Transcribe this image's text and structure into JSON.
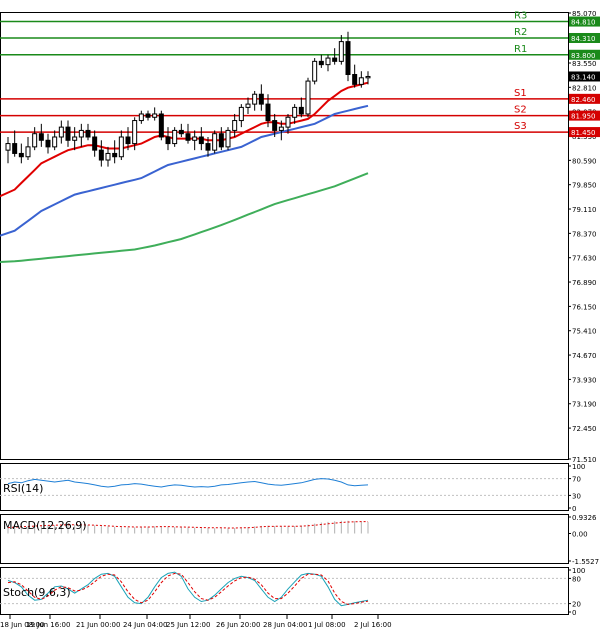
{
  "chart_data": {
    "type": "line",
    "instrument_hint": "",
    "price_axis": {
      "ylim": [
        71.51,
        85.07
      ],
      "ticks": [
        "85.070",
        "84.290",
        "83.550",
        "82.810",
        "82.070",
        "81.330",
        "80.590",
        "79.850",
        "79.110",
        "78.370",
        "77.630",
        "76.890",
        "76.150",
        "75.410",
        "74.670",
        "73.930",
        "73.190",
        "72.450",
        "71.510"
      ]
    },
    "time_labels": [
      "18 Jun 08:00",
      "19 Jun 16:00",
      "21 Jun 00:00",
      "24 Jun 04:00",
      "25 Jun 12:00",
      "26 Jun 20:00",
      "28 Jun 04:00",
      "1 Jul 08:00",
      "2 Jul 16:00"
    ],
    "current_price": {
      "label": "83.140",
      "value": 83.14
    },
    "levels": [
      {
        "name": "R3",
        "value": 84.81,
        "label": "84.810",
        "color": "#1a8a1a"
      },
      {
        "name": "R2",
        "value": 84.31,
        "label": "84.310",
        "color": "#1a8a1a"
      },
      {
        "name": "R1",
        "value": 83.8,
        "label": "83.800",
        "color": "#1a8a1a"
      },
      {
        "name": "S1",
        "value": 82.46,
        "label": "82.460",
        "color": "#d40000"
      },
      {
        "name": "S2",
        "value": 81.95,
        "label": "81.950",
        "color": "#d40000"
      },
      {
        "name": "S3",
        "value": 81.45,
        "label": "81.450",
        "color": "#d40000"
      }
    ],
    "candles": [
      {
        "o": 80.9,
        "h": 81.3,
        "l": 80.5,
        "c": 81.1
      },
      {
        "o": 81.1,
        "h": 81.5,
        "l": 80.7,
        "c": 80.8
      },
      {
        "o": 80.8,
        "h": 81.1,
        "l": 80.5,
        "c": 80.7
      },
      {
        "o": 80.7,
        "h": 81.3,
        "l": 80.6,
        "c": 81.0
      },
      {
        "o": 81.0,
        "h": 81.6,
        "l": 80.9,
        "c": 81.4
      },
      {
        "o": 81.4,
        "h": 81.7,
        "l": 81.0,
        "c": 81.2
      },
      {
        "o": 81.2,
        "h": 81.4,
        "l": 80.8,
        "c": 81.0
      },
      {
        "o": 81.0,
        "h": 81.5,
        "l": 80.9,
        "c": 81.3
      },
      {
        "o": 81.3,
        "h": 81.8,
        "l": 81.1,
        "c": 81.6
      },
      {
        "o": 81.6,
        "h": 81.8,
        "l": 81.0,
        "c": 81.2
      },
      {
        "o": 81.2,
        "h": 81.6,
        "l": 80.9,
        "c": 81.3
      },
      {
        "o": 81.3,
        "h": 81.7,
        "l": 81.0,
        "c": 81.5
      },
      {
        "o": 81.5,
        "h": 81.7,
        "l": 81.2,
        "c": 81.3
      },
      {
        "o": 81.3,
        "h": 81.5,
        "l": 80.7,
        "c": 80.9
      },
      {
        "o": 80.9,
        "h": 81.2,
        "l": 80.4,
        "c": 80.6
      },
      {
        "o": 80.6,
        "h": 81.0,
        "l": 80.4,
        "c": 80.8
      },
      {
        "o": 80.8,
        "h": 81.2,
        "l": 80.5,
        "c": 80.7
      },
      {
        "o": 80.7,
        "h": 81.5,
        "l": 80.6,
        "c": 81.3
      },
      {
        "o": 81.3,
        "h": 81.6,
        "l": 80.9,
        "c": 81.1
      },
      {
        "o": 81.1,
        "h": 81.9,
        "l": 80.9,
        "c": 81.8
      },
      {
        "o": 81.8,
        "h": 82.1,
        "l": 81.7,
        "c": 82.0
      },
      {
        "o": 82.0,
        "h": 82.1,
        "l": 81.8,
        "c": 81.9
      },
      {
        "o": 81.9,
        "h": 82.2,
        "l": 81.8,
        "c": 82.0
      },
      {
        "o": 82.0,
        "h": 82.1,
        "l": 81.2,
        "c": 81.3
      },
      {
        "o": 81.3,
        "h": 81.6,
        "l": 80.9,
        "c": 81.1
      },
      {
        "o": 81.1,
        "h": 81.6,
        "l": 81.0,
        "c": 81.5
      },
      {
        "o": 81.5,
        "h": 81.7,
        "l": 81.3,
        "c": 81.4
      },
      {
        "o": 81.4,
        "h": 81.7,
        "l": 81.1,
        "c": 81.2
      },
      {
        "o": 81.2,
        "h": 81.5,
        "l": 80.9,
        "c": 81.3
      },
      {
        "o": 81.3,
        "h": 81.6,
        "l": 80.9,
        "c": 81.1
      },
      {
        "o": 81.1,
        "h": 81.3,
        "l": 80.7,
        "c": 80.9
      },
      {
        "o": 80.9,
        "h": 81.5,
        "l": 80.8,
        "c": 81.4
      },
      {
        "o": 81.4,
        "h": 81.6,
        "l": 80.9,
        "c": 81.0
      },
      {
        "o": 81.0,
        "h": 81.6,
        "l": 80.9,
        "c": 81.5
      },
      {
        "o": 81.5,
        "h": 82.0,
        "l": 81.3,
        "c": 81.8
      },
      {
        "o": 81.8,
        "h": 82.3,
        "l": 81.6,
        "c": 82.2
      },
      {
        "o": 82.2,
        "h": 82.5,
        "l": 82.0,
        "c": 82.3
      },
      {
        "o": 82.3,
        "h": 82.7,
        "l": 82.1,
        "c": 82.6
      },
      {
        "o": 82.6,
        "h": 82.9,
        "l": 82.1,
        "c": 82.3
      },
      {
        "o": 82.3,
        "h": 82.6,
        "l": 81.6,
        "c": 81.8
      },
      {
        "o": 81.8,
        "h": 82.0,
        "l": 81.3,
        "c": 81.5
      },
      {
        "o": 81.5,
        "h": 81.8,
        "l": 81.2,
        "c": 81.6
      },
      {
        "o": 81.6,
        "h": 82.0,
        "l": 81.4,
        "c": 81.9
      },
      {
        "o": 81.9,
        "h": 82.3,
        "l": 81.7,
        "c": 82.2
      },
      {
        "o": 82.2,
        "h": 82.5,
        "l": 81.9,
        "c": 82.0
      },
      {
        "o": 82.0,
        "h": 83.1,
        "l": 81.9,
        "c": 83.0
      },
      {
        "o": 83.0,
        "h": 83.7,
        "l": 82.9,
        "c": 83.6
      },
      {
        "o": 83.6,
        "h": 83.8,
        "l": 83.4,
        "c": 83.5
      },
      {
        "o": 83.5,
        "h": 83.8,
        "l": 83.3,
        "c": 83.7
      },
      {
        "o": 83.7,
        "h": 84.0,
        "l": 83.5,
        "c": 83.6
      },
      {
        "o": 83.6,
        "h": 84.4,
        "l": 83.5,
        "c": 84.2
      },
      {
        "o": 84.2,
        "h": 84.5,
        "l": 83.0,
        "c": 83.2
      },
      {
        "o": 83.2,
        "h": 83.5,
        "l": 82.8,
        "c": 82.9
      },
      {
        "o": 82.9,
        "h": 83.3,
        "l": 82.8,
        "c": 83.1
      },
      {
        "o": 83.1,
        "h": 83.3,
        "l": 82.9,
        "c": 83.14
      }
    ],
    "series": [
      {
        "color": "#e00000",
        "values": [
          79.5,
          79.7,
          79.9,
          80.1,
          80.3,
          80.5,
          80.6,
          80.7,
          80.8,
          80.9,
          80.95,
          81.0,
          81.05,
          81.05,
          81.0,
          80.95,
          80.95,
          80.95,
          81.0,
          81.05,
          81.1,
          81.2,
          81.3,
          81.35,
          81.3,
          81.25,
          81.25,
          81.25,
          81.25,
          81.25,
          81.2,
          81.2,
          81.2,
          81.25,
          81.3,
          81.4,
          81.5,
          81.6,
          81.7,
          81.75,
          81.75,
          81.7,
          81.7,
          81.75,
          81.8,
          81.85,
          82.0,
          82.2,
          82.4,
          82.55,
          82.7,
          82.8,
          82.85,
          82.9,
          82.95
        ]
      },
      {
        "color": "#3a63d1",
        "values": [
          78.3,
          78.45,
          78.6,
          78.75,
          78.9,
          79.05,
          79.15,
          79.25,
          79.35,
          79.45,
          79.55,
          79.6,
          79.65,
          79.7,
          79.75,
          79.8,
          79.85,
          79.9,
          79.95,
          80.0,
          80.05,
          80.15,
          80.25,
          80.35,
          80.45,
          80.5,
          80.55,
          80.6,
          80.65,
          80.7,
          80.75,
          80.8,
          80.85,
          80.9,
          80.95,
          81.0,
          81.1,
          81.2,
          81.3,
          81.35,
          81.4,
          81.45,
          81.5,
          81.55,
          81.6,
          81.65,
          81.7,
          81.8,
          81.9,
          82.0,
          82.05,
          82.1,
          82.15,
          82.2,
          82.25
        ]
      },
      {
        "color": "#3fae5a",
        "values": [
          77.5,
          77.52,
          77.54,
          77.56,
          77.58,
          77.6,
          77.62,
          77.64,
          77.66,
          77.68,
          77.7,
          77.72,
          77.74,
          77.76,
          77.78,
          77.8,
          77.82,
          77.84,
          77.86,
          77.88,
          77.92,
          77.96,
          78.0,
          78.05,
          78.1,
          78.15,
          78.2,
          78.27,
          78.34,
          78.41,
          78.48,
          78.55,
          78.62,
          78.7,
          78.78,
          78.86,
          78.94,
          79.02,
          79.1,
          79.18,
          79.26,
          79.32,
          79.38,
          79.44,
          79.5,
          79.56,
          79.62,
          79.68,
          79.74,
          79.8,
          79.88,
          79.96,
          80.04,
          80.12,
          80.2
        ]
      }
    ],
    "rsi": {
      "label": "RSI(14)",
      "ticks": [
        "100",
        "70",
        "30",
        "0"
      ],
      "ylim": [
        0,
        100
      ],
      "values": [
        58,
        62,
        60,
        65,
        68,
        66,
        64,
        62,
        64,
        66,
        62,
        60,
        58,
        55,
        52,
        50,
        52,
        55,
        56,
        58,
        57,
        54,
        52,
        50,
        53,
        55,
        54,
        52,
        50,
        51,
        50,
        52,
        55,
        56,
        58,
        60,
        62,
        63,
        60,
        57,
        55,
        54,
        56,
        58,
        60,
        64,
        68,
        70,
        69,
        66,
        62,
        55,
        53,
        54,
        55
      ]
    },
    "macd": {
      "label": "MACD(12,26,9)",
      "ticks": [
        "0.9326",
        "0.00",
        "-1.5527"
      ],
      "ylim": [
        -1.5527,
        0.9326
      ],
      "histogram": [
        0.35,
        0.38,
        0.4,
        0.42,
        0.45,
        0.47,
        0.48,
        0.48,
        0.49,
        0.5,
        0.5,
        0.49,
        0.48,
        0.46,
        0.43,
        0.4,
        0.38,
        0.36,
        0.35,
        0.35,
        0.36,
        0.38,
        0.4,
        0.4,
        0.38,
        0.36,
        0.35,
        0.34,
        0.33,
        0.32,
        0.31,
        0.3,
        0.3,
        0.3,
        0.31,
        0.33,
        0.36,
        0.4,
        0.43,
        0.44,
        0.42,
        0.4,
        0.4,
        0.42,
        0.45,
        0.5,
        0.56,
        0.62,
        0.66,
        0.69,
        0.72,
        0.72,
        0.7,
        0.68,
        0.66
      ],
      "signal": [
        0.33,
        0.36,
        0.38,
        0.4,
        0.42,
        0.44,
        0.46,
        0.47,
        0.48,
        0.49,
        0.49,
        0.49,
        0.48,
        0.47,
        0.45,
        0.43,
        0.41,
        0.39,
        0.38,
        0.37,
        0.37,
        0.37,
        0.38,
        0.39,
        0.39,
        0.38,
        0.37,
        0.36,
        0.35,
        0.34,
        0.33,
        0.32,
        0.32,
        0.31,
        0.31,
        0.32,
        0.33,
        0.35,
        0.38,
        0.4,
        0.41,
        0.41,
        0.41,
        0.41,
        0.42,
        0.44,
        0.47,
        0.51,
        0.55,
        0.59,
        0.62,
        0.65,
        0.66,
        0.67,
        0.67
      ]
    },
    "stoch": {
      "label": "Stoch(9,6,3)",
      "ticks": [
        "100",
        "80",
        "20",
        "0"
      ],
      "ylim": [
        0,
        100
      ],
      "k": [
        75,
        70,
        60,
        40,
        28,
        30,
        45,
        60,
        62,
        55,
        45,
        55,
        65,
        80,
        90,
        92,
        85,
        60,
        35,
        22,
        20,
        35,
        60,
        82,
        92,
        95,
        85,
        55,
        35,
        25,
        28,
        40,
        55,
        70,
        80,
        85,
        82,
        75,
        55,
        35,
        25,
        35,
        55,
        72,
        88,
        92,
        90,
        85,
        60,
        30,
        15,
        18,
        22,
        25,
        28
      ],
      "d": [
        70,
        72,
        65,
        50,
        35,
        30,
        38,
        52,
        60,
        58,
        50,
        52,
        60,
        72,
        85,
        90,
        88,
        72,
        48,
        30,
        22,
        28,
        48,
        70,
        86,
        92,
        90,
        70,
        48,
        32,
        28,
        35,
        48,
        62,
        74,
        82,
        83,
        78,
        65,
        45,
        32,
        32,
        45,
        62,
        80,
        90,
        90,
        88,
        74,
        45,
        25,
        18,
        20,
        23,
        26
      ]
    }
  }
}
